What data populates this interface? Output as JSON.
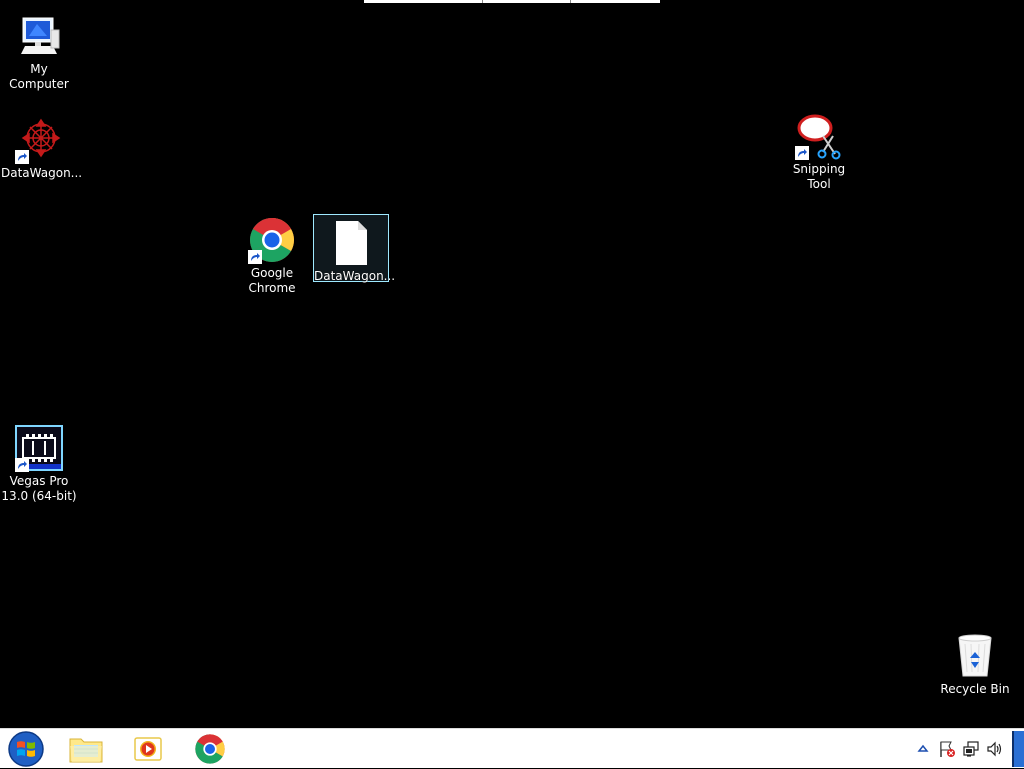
{
  "desktop": {
    "icons": [
      {
        "name": "my-computer",
        "label": "My Computer",
        "icon": "computer-icon",
        "shortcut": false
      },
      {
        "name": "datawagon-app",
        "label": "DataWagon...",
        "icon": "datawagon-icon",
        "shortcut": true
      },
      {
        "name": "google-chrome",
        "label": "Google\nChrome",
        "icon": "chrome-icon",
        "shortcut": true
      },
      {
        "name": "datawagon-file",
        "label": "DataWagon...",
        "icon": "document-icon",
        "shortcut": false,
        "selected": true
      },
      {
        "name": "vegas-pro",
        "label": "Vegas Pro\n13.0 (64-bit)",
        "icon": "vegas-pro-icon",
        "shortcut": true
      },
      {
        "name": "snipping-tool",
        "label": "Snipping Tool",
        "icon": "scissors-icon",
        "shortcut": true
      },
      {
        "name": "recycle-bin",
        "label": "Recycle Bin",
        "icon": "recycle-bin-icon",
        "shortcut": false
      }
    ]
  },
  "taskbar": {
    "start": {
      "icon": "windows-start-icon"
    },
    "pinned": [
      {
        "name": "file-explorer",
        "icon": "folder-icon"
      },
      {
        "name": "media-player",
        "icon": "media-player-icon"
      },
      {
        "name": "chrome",
        "icon": "chrome-icon"
      }
    ],
    "tray": [
      {
        "name": "show-hidden-icons",
        "icon": "chevron-up-icon"
      },
      {
        "name": "action-center",
        "icon": "flag-icon"
      },
      {
        "name": "network",
        "icon": "network-icon"
      },
      {
        "name": "volume",
        "icon": "speaker-icon"
      }
    ]
  },
  "colors": {
    "desktop_bg": "#000000",
    "taskbar_bg": "#ffffff",
    "selection_border": "#9fe9ff",
    "label_text": "#ffffff"
  }
}
